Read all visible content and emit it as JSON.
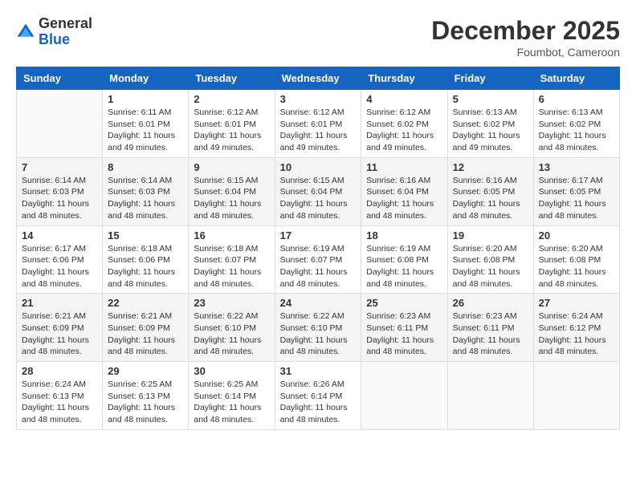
{
  "logo": {
    "general": "General",
    "blue": "Blue"
  },
  "title": "December 2025",
  "location": "Foumbot, Cameroon",
  "days_header": [
    "Sunday",
    "Monday",
    "Tuesday",
    "Wednesday",
    "Thursday",
    "Friday",
    "Saturday"
  ],
  "weeks": [
    [
      {
        "day": "",
        "sunrise": "",
        "sunset": "",
        "daylight": ""
      },
      {
        "day": "1",
        "sunrise": "Sunrise: 6:11 AM",
        "sunset": "Sunset: 6:01 PM",
        "daylight": "Daylight: 11 hours and 49 minutes."
      },
      {
        "day": "2",
        "sunrise": "Sunrise: 6:12 AM",
        "sunset": "Sunset: 6:01 PM",
        "daylight": "Daylight: 11 hours and 49 minutes."
      },
      {
        "day": "3",
        "sunrise": "Sunrise: 6:12 AM",
        "sunset": "Sunset: 6:01 PM",
        "daylight": "Daylight: 11 hours and 49 minutes."
      },
      {
        "day": "4",
        "sunrise": "Sunrise: 6:12 AM",
        "sunset": "Sunset: 6:02 PM",
        "daylight": "Daylight: 11 hours and 49 minutes."
      },
      {
        "day": "5",
        "sunrise": "Sunrise: 6:13 AM",
        "sunset": "Sunset: 6:02 PM",
        "daylight": "Daylight: 11 hours and 49 minutes."
      },
      {
        "day": "6",
        "sunrise": "Sunrise: 6:13 AM",
        "sunset": "Sunset: 6:02 PM",
        "daylight": "Daylight: 11 hours and 48 minutes."
      }
    ],
    [
      {
        "day": "7",
        "sunrise": "Sunrise: 6:14 AM",
        "sunset": "Sunset: 6:03 PM",
        "daylight": "Daylight: 11 hours and 48 minutes."
      },
      {
        "day": "8",
        "sunrise": "Sunrise: 6:14 AM",
        "sunset": "Sunset: 6:03 PM",
        "daylight": "Daylight: 11 hours and 48 minutes."
      },
      {
        "day": "9",
        "sunrise": "Sunrise: 6:15 AM",
        "sunset": "Sunset: 6:04 PM",
        "daylight": "Daylight: 11 hours and 48 minutes."
      },
      {
        "day": "10",
        "sunrise": "Sunrise: 6:15 AM",
        "sunset": "Sunset: 6:04 PM",
        "daylight": "Daylight: 11 hours and 48 minutes."
      },
      {
        "day": "11",
        "sunrise": "Sunrise: 6:16 AM",
        "sunset": "Sunset: 6:04 PM",
        "daylight": "Daylight: 11 hours and 48 minutes."
      },
      {
        "day": "12",
        "sunrise": "Sunrise: 6:16 AM",
        "sunset": "Sunset: 6:05 PM",
        "daylight": "Daylight: 11 hours and 48 minutes."
      },
      {
        "day": "13",
        "sunrise": "Sunrise: 6:17 AM",
        "sunset": "Sunset: 6:05 PM",
        "daylight": "Daylight: 11 hours and 48 minutes."
      }
    ],
    [
      {
        "day": "14",
        "sunrise": "Sunrise: 6:17 AM",
        "sunset": "Sunset: 6:06 PM",
        "daylight": "Daylight: 11 hours and 48 minutes."
      },
      {
        "day": "15",
        "sunrise": "Sunrise: 6:18 AM",
        "sunset": "Sunset: 6:06 PM",
        "daylight": "Daylight: 11 hours and 48 minutes."
      },
      {
        "day": "16",
        "sunrise": "Sunrise: 6:18 AM",
        "sunset": "Sunset: 6:07 PM",
        "daylight": "Daylight: 11 hours and 48 minutes."
      },
      {
        "day": "17",
        "sunrise": "Sunrise: 6:19 AM",
        "sunset": "Sunset: 6:07 PM",
        "daylight": "Daylight: 11 hours and 48 minutes."
      },
      {
        "day": "18",
        "sunrise": "Sunrise: 6:19 AM",
        "sunset": "Sunset: 6:08 PM",
        "daylight": "Daylight: 11 hours and 48 minutes."
      },
      {
        "day": "19",
        "sunrise": "Sunrise: 6:20 AM",
        "sunset": "Sunset: 6:08 PM",
        "daylight": "Daylight: 11 hours and 48 minutes."
      },
      {
        "day": "20",
        "sunrise": "Sunrise: 6:20 AM",
        "sunset": "Sunset: 6:08 PM",
        "daylight": "Daylight: 11 hours and 48 minutes."
      }
    ],
    [
      {
        "day": "21",
        "sunrise": "Sunrise: 6:21 AM",
        "sunset": "Sunset: 6:09 PM",
        "daylight": "Daylight: 11 hours and 48 minutes."
      },
      {
        "day": "22",
        "sunrise": "Sunrise: 6:21 AM",
        "sunset": "Sunset: 6:09 PM",
        "daylight": "Daylight: 11 hours and 48 minutes."
      },
      {
        "day": "23",
        "sunrise": "Sunrise: 6:22 AM",
        "sunset": "Sunset: 6:10 PM",
        "daylight": "Daylight: 11 hours and 48 minutes."
      },
      {
        "day": "24",
        "sunrise": "Sunrise: 6:22 AM",
        "sunset": "Sunset: 6:10 PM",
        "daylight": "Daylight: 11 hours and 48 minutes."
      },
      {
        "day": "25",
        "sunrise": "Sunrise: 6:23 AM",
        "sunset": "Sunset: 6:11 PM",
        "daylight": "Daylight: 11 hours and 48 minutes."
      },
      {
        "day": "26",
        "sunrise": "Sunrise: 6:23 AM",
        "sunset": "Sunset: 6:11 PM",
        "daylight": "Daylight: 11 hours and 48 minutes."
      },
      {
        "day": "27",
        "sunrise": "Sunrise: 6:24 AM",
        "sunset": "Sunset: 6:12 PM",
        "daylight": "Daylight: 11 hours and 48 minutes."
      }
    ],
    [
      {
        "day": "28",
        "sunrise": "Sunrise: 6:24 AM",
        "sunset": "Sunset: 6:13 PM",
        "daylight": "Daylight: 11 hours and 48 minutes."
      },
      {
        "day": "29",
        "sunrise": "Sunrise: 6:25 AM",
        "sunset": "Sunset: 6:13 PM",
        "daylight": "Daylight: 11 hours and 48 minutes."
      },
      {
        "day": "30",
        "sunrise": "Sunrise: 6:25 AM",
        "sunset": "Sunset: 6:14 PM",
        "daylight": "Daylight: 11 hours and 48 minutes."
      },
      {
        "day": "31",
        "sunrise": "Sunrise: 6:26 AM",
        "sunset": "Sunset: 6:14 PM",
        "daylight": "Daylight: 11 hours and 48 minutes."
      },
      {
        "day": "",
        "sunrise": "",
        "sunset": "",
        "daylight": ""
      },
      {
        "day": "",
        "sunrise": "",
        "sunset": "",
        "daylight": ""
      },
      {
        "day": "",
        "sunrise": "",
        "sunset": "",
        "daylight": ""
      }
    ]
  ]
}
